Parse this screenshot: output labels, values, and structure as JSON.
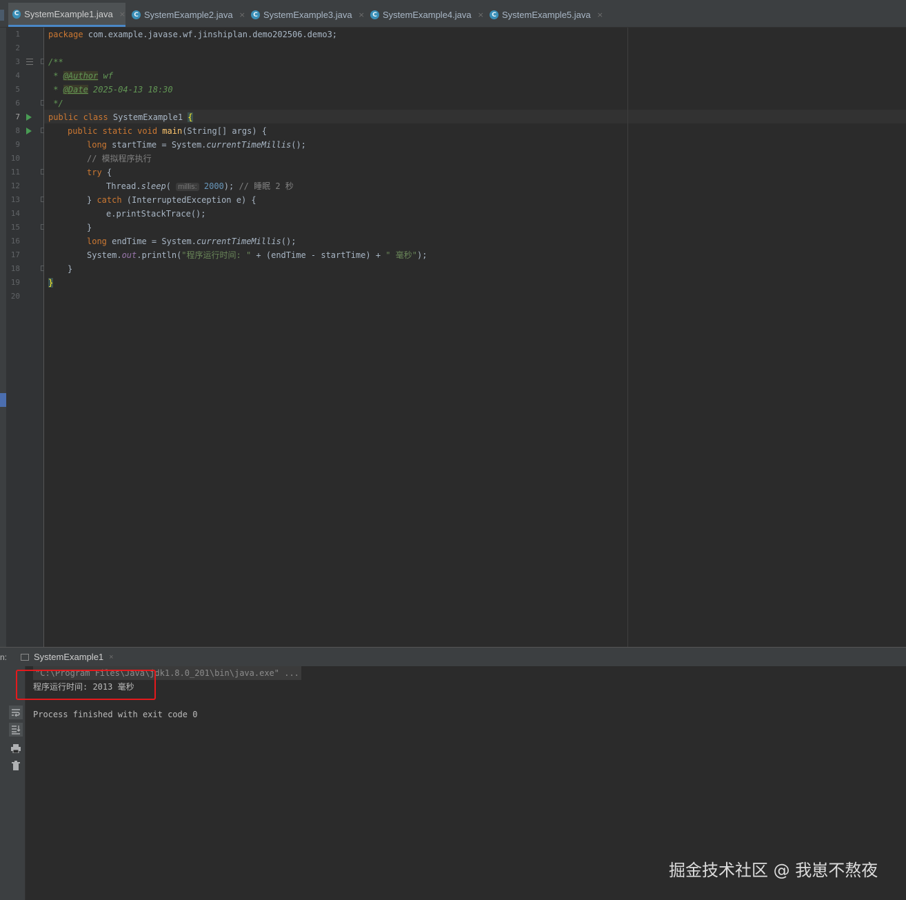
{
  "tabs": [
    {
      "label": "SystemExample1.java",
      "active": true
    },
    {
      "label": "SystemExample2.java",
      "active": false
    },
    {
      "label": "SystemExample3.java",
      "active": false
    },
    {
      "label": "SystemExample4.java",
      "active": false
    },
    {
      "label": "SystemExample5.java",
      "active": false
    }
  ],
  "tab_close_glyph": "×",
  "tab_icon_glyph": "C",
  "line_numbers": [
    "1",
    "2",
    "3",
    "4",
    "5",
    "6",
    "7",
    "8",
    "9",
    "10",
    "11",
    "12",
    "13",
    "14",
    "15",
    "16",
    "17",
    "18",
    "19",
    "20"
  ],
  "current_line": "7",
  "code": {
    "l1": {
      "kw": "package",
      "text": " com.example.javase.wf.jinshiplan.demo202506.demo3;"
    },
    "l3": {
      "text": "/**"
    },
    "l4": {
      "star": " * ",
      "tag": "@Author",
      "val": " wf"
    },
    "l5": {
      "star": " * ",
      "tag": "@Date",
      "val": " 2025-04-13 18:30"
    },
    "l6": {
      "text": " */"
    },
    "l7": {
      "kw": "public class",
      "name": " SystemExample1 ",
      "brace": "{"
    },
    "l8": {
      "kw": "public static void",
      "meth": "main",
      "rest": "(String[] args) {"
    },
    "l9": {
      "kw": "long",
      "pre": " startTime = System.",
      "call": "currentTimeMillis",
      "post": "();"
    },
    "l10": {
      "comment": "// 模拟程序执行"
    },
    "l11": {
      "kw": "try",
      "rest": " {"
    },
    "l12": {
      "pre": "Thread.",
      "call": "sleep",
      "open": "( ",
      "hint": "millis:",
      "num": " 2000",
      "close": ");",
      "comment": " // 睡眠 2 秒"
    },
    "l13": {
      "pre": "} ",
      "kw": "catch",
      "rest": " (InterruptedException e) {"
    },
    "l14": {
      "text": "e.printStackTrace();"
    },
    "l15": {
      "text": "}"
    },
    "l16": {
      "kw": "long",
      "pre": " endTime = System.",
      "call": "currentTimeMillis",
      "post": "();"
    },
    "l17": {
      "pre": "System.",
      "field": "out",
      "mid": ".println(",
      "str1": "\"程序运行时间: \"",
      "mid2": " + (endTime - startTime) + ",
      "str2": "\" 毫秒\"",
      "end": ");"
    },
    "l18": {
      "text": "}"
    },
    "l19": {
      "brace": "}"
    }
  },
  "run_panel": {
    "label": "n:",
    "tab_label": "SystemExample1",
    "close_glyph": "×",
    "console_lines": {
      "command": "\"C:\\Program Files\\Java\\jdk1.8.0_201\\bin\\java.exe\" ...",
      "output": "程序运行时间: 2013 毫秒",
      "exit": "Process finished with exit code 0"
    },
    "toolbar_icons": [
      "soft-wrap-icon",
      "scroll-to-end-icon",
      "print-icon",
      "trash-icon"
    ]
  },
  "watermark": "掘金技术社区 @ 我崽不熬夜"
}
